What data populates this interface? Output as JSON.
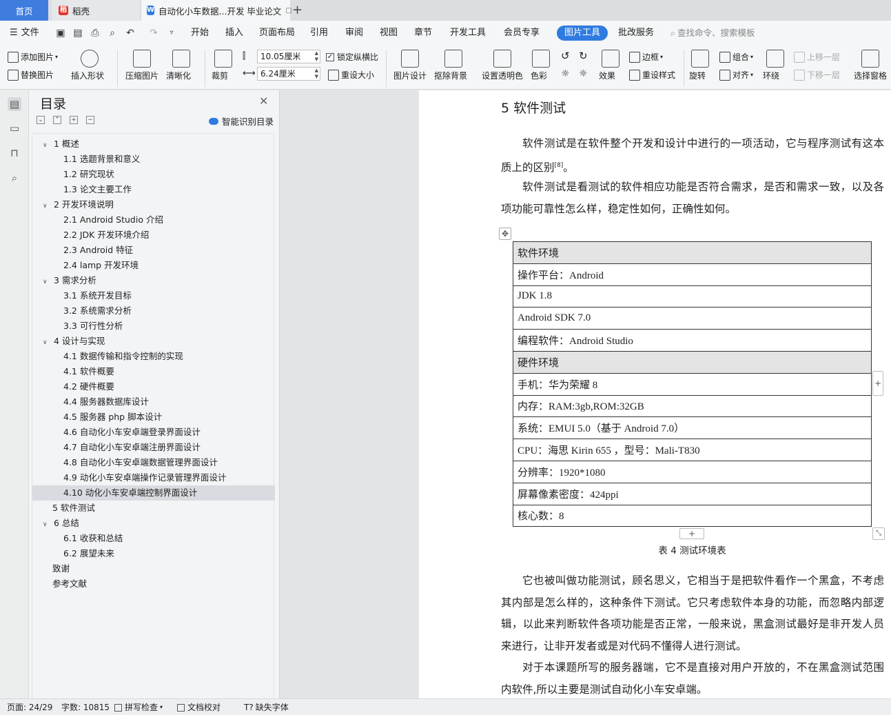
{
  "tabs": {
    "home": "首页",
    "daoke": "稻壳",
    "document": "自动化小车数据...开发 毕业论文"
  },
  "menu": {
    "file": "文件",
    "items": [
      "开始",
      "插入",
      "页面布局",
      "引用",
      "审阅",
      "视图",
      "章节",
      "开发工具",
      "会员专享"
    ],
    "active": "图片工具",
    "after": "批改服务",
    "search_placeholder": "查找命令、搜索模板"
  },
  "ribbon": {
    "add_image": "添加图片",
    "replace_image": "替换图片",
    "insert_shape": "插入形状",
    "compress": "压缩图片",
    "clarity": "清晰化",
    "crop": "裁剪",
    "width": "10.05厘米",
    "height": "6.24厘米",
    "lock_ratio": "锁定纵横比",
    "reset_size": "重设大小",
    "image_design": "图片设计",
    "remove_bg": "抠除背景",
    "set_transparent": "设置透明色",
    "color": "色彩",
    "effects": "效果",
    "border": "边框",
    "reset_style": "重设样式",
    "rotate": "旋转",
    "group": "组合",
    "align": "对齐",
    "wrap": "环绕",
    "bring_forward": "上移一层",
    "send_backward": "下移一层",
    "selection_pane": "选择窗格"
  },
  "toc": {
    "title": "目录",
    "smart": "智能识别目录",
    "items": [
      {
        "label": "1 概述",
        "level": 1,
        "expandable": true
      },
      {
        "label": "1.1 选题背景和意义",
        "level": 2
      },
      {
        "label": "1.2 研究现状",
        "level": 2
      },
      {
        "label": "1.3 论文主要工作",
        "level": 2
      },
      {
        "label": "2  开发环境说明",
        "level": 1,
        "expandable": true
      },
      {
        "label": "2.1 Android Studio 介绍",
        "level": 2
      },
      {
        "label": "2.2 JDK 开发环境介绍",
        "level": 2
      },
      {
        "label": "2.3 Android 特征",
        "level": 2
      },
      {
        "label": "2.4 lamp 开发环境",
        "level": 2
      },
      {
        "label": "3  需求分析",
        "level": 1,
        "expandable": true
      },
      {
        "label": "3.1 系统开发目标",
        "level": 2
      },
      {
        "label": "3.2 系统需求分析",
        "level": 2
      },
      {
        "label": "3.3 可行性分析",
        "level": 2
      },
      {
        "label": "4  设计与实现",
        "level": 1,
        "expandable": true
      },
      {
        "label": "4.1 数据传输和指令控制的实现",
        "level": 2
      },
      {
        "label": "4.1 软件概要",
        "level": 2
      },
      {
        "label": "4.2 硬件概要",
        "level": 2
      },
      {
        "label": "4.4 服务器数据库设计",
        "level": 2
      },
      {
        "label": "4.5 服务器 php 脚本设计",
        "level": 2
      },
      {
        "label": "4.6 自动化小车安卓端登录界面设计",
        "level": 2
      },
      {
        "label": "4.7 自动化小车安卓端注册界面设计",
        "level": 2
      },
      {
        "label": "4.8 自动化小车安卓端数据管理界面设计",
        "level": 2
      },
      {
        "label": "4.9 动化小车安卓端操作记录管理界面设计",
        "level": 2
      },
      {
        "label": "4.10 动化小车安卓端控制界面设计",
        "level": 2,
        "selected": true
      },
      {
        "label": "5  软件测试",
        "level": 1
      },
      {
        "label": "6 总结",
        "level": 1,
        "expandable": true
      },
      {
        "label": "6.1 收获和总结",
        "level": 2
      },
      {
        "label": "6.2 展望未来",
        "level": 2
      },
      {
        "label": "致谢",
        "level": 0
      },
      {
        "label": "参考文献",
        "level": 0
      }
    ]
  },
  "document": {
    "heading": "5  软件测试",
    "p1_a": "软件测试是在软件整个开发和设计中进行的一项活动，它与程序测试有这本质上的区别",
    "p1_ref": "[8]",
    "p1_b": "。",
    "p2": "软件测试是看测试的软件相应功能是否符合需求，是否和需求一致，以及各项功能可靠性怎么样，稳定性如何，正确性如何。",
    "table_rows": [
      {
        "text": "软件环境",
        "header": true
      },
      {
        "text": "操作平台：Android"
      },
      {
        "text": "JDK 1.8"
      },
      {
        "text": "Android SDK 7.0"
      },
      {
        "text": "编程软件：Android Studio"
      },
      {
        "text": "硬件环境",
        "header": true
      },
      {
        "text": "手机：华为荣耀 8"
      },
      {
        "text": "内存：RAM:3gb,ROM:32GB"
      },
      {
        "text": "系统：EMUI 5.0（基于 Android 7.0）"
      },
      {
        "text": "CPU：海思  Kirin 655 ，型号：Mali-T830"
      },
      {
        "text": "分辨率：1920*1080"
      },
      {
        "text": "屏幕像素密度：424ppi"
      },
      {
        "text": "核心数：8"
      }
    ],
    "caption": "表 4  测试环境表",
    "p3": "它也被叫做功能测试，顾名思义，它相当于是把软件看作一个黑盒，不考虑其内部是怎么样的，这种条件下测试。它只考虑软件本身的功能，而忽略内部逻辑，以此来判断软件各项功能是否正常，一般来说，黑盒测试最好是非开发人员来进行，让非开发者或是对代码不懂得人进行测试。",
    "p4": "对于本课题所写的服务器端，它不是直接对用户开放的，不在黑盒测试范围内软件,所以主要是测试自动化小车安卓端。"
  },
  "status": {
    "page": "页面: 24/29",
    "words": "字数: 10815",
    "spell": "拼写检查",
    "proof": "文档校对",
    "missing_font": "缺失字体"
  },
  "colors": {
    "accent": "#2f7be0",
    "table_header_bg": "#e4e4e4",
    "toc_selected_bg": "#d9dbe0"
  }
}
